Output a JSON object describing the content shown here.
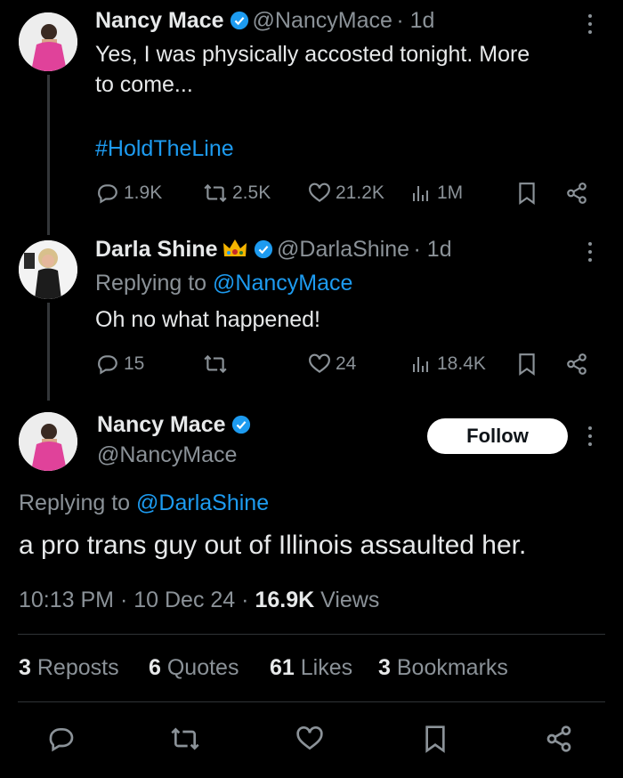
{
  "tweet1": {
    "name": "Nancy Mace",
    "handle": "@NancyMace",
    "time": "· 1d",
    "text_line1": "Yes, I was physically accosted tonight. More",
    "text_line2": "to come...",
    "hashtag": "#HoldTheLine",
    "replies": "1.9K",
    "reposts": "2.5K",
    "likes": "21.2K",
    "views": "1M"
  },
  "tweet2": {
    "name": "Darla Shine",
    "handle": "@DarlaShine",
    "time": "· 1d",
    "replying_prefix": "Replying to",
    "replying_to": "@NancyMace",
    "text": "Oh no what happened!",
    "replies": "15",
    "likes": "24",
    "views": "18.4K"
  },
  "main": {
    "name": "Nancy Mace",
    "handle": "@NancyMace",
    "follow_label": "Follow",
    "replying_prefix": "Replying to",
    "replying_to": "@DarlaShine",
    "text": "a pro trans guy out of Illinois assaulted her.",
    "time": "10:13 PM",
    "date": "10 Dec 24",
    "views_count": "16.9K",
    "views_label": "Views",
    "sep": "·"
  },
  "stats": {
    "reposts_count": "3",
    "reposts_label": "Reposts",
    "quotes_count": "6",
    "quotes_label": "Quotes",
    "likes_count": "61",
    "likes_label": "Likes",
    "bookmarks_count": "3",
    "bookmarks_label": "Bookmarks"
  },
  "colors": {
    "background": "#000000",
    "text": "#e7e9ea",
    "muted": "#8b9298",
    "link": "#1d9bf0",
    "verified": "#1d9bf0",
    "crown": "#f4b400"
  },
  "icons": [
    "reply-icon",
    "repost-icon",
    "like-icon",
    "views-icon",
    "bookmark-icon",
    "share-icon",
    "more-icon",
    "verified-icon",
    "crown-icon"
  ]
}
